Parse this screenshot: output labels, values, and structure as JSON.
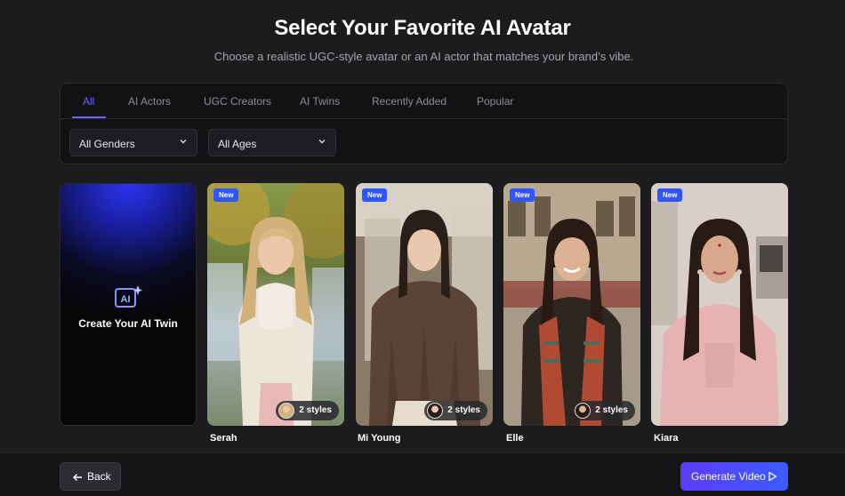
{
  "header": {
    "title": "Select Your Favorite AI Avatar",
    "subtitle": "Choose a realistic UGC-style avatar or an AI actor that matches your brand’s vibe."
  },
  "tabs": [
    {
      "label": "All",
      "active": true
    },
    {
      "label": "AI Actors",
      "active": false
    },
    {
      "label": "UGC Creators",
      "active": false
    },
    {
      "label": "AI Twins",
      "active": false
    },
    {
      "label": "Recently Added",
      "active": false
    },
    {
      "label": "Popular",
      "active": false
    }
  ],
  "filters": {
    "gender": {
      "selected": "All Genders"
    },
    "age": {
      "selected": "All Ages"
    }
  },
  "create_card": {
    "label": "Create Your AI Twin",
    "icon_text": "AI"
  },
  "avatars": [
    {
      "name": "Serah",
      "badge": "New",
      "styles": "2 styles"
    },
    {
      "name": "Mi Young",
      "badge": "New",
      "styles": "2 styles"
    },
    {
      "name": "Elle",
      "badge": "New",
      "styles": "2 styles"
    },
    {
      "name": "Kiara",
      "badge": "New"
    }
  ],
  "footer": {
    "back_label": "Back",
    "generate_label": "Generate Video"
  },
  "colors": {
    "accent": "#6d63ff",
    "badge": "#2e55ff",
    "background": "#1c1c1f"
  }
}
